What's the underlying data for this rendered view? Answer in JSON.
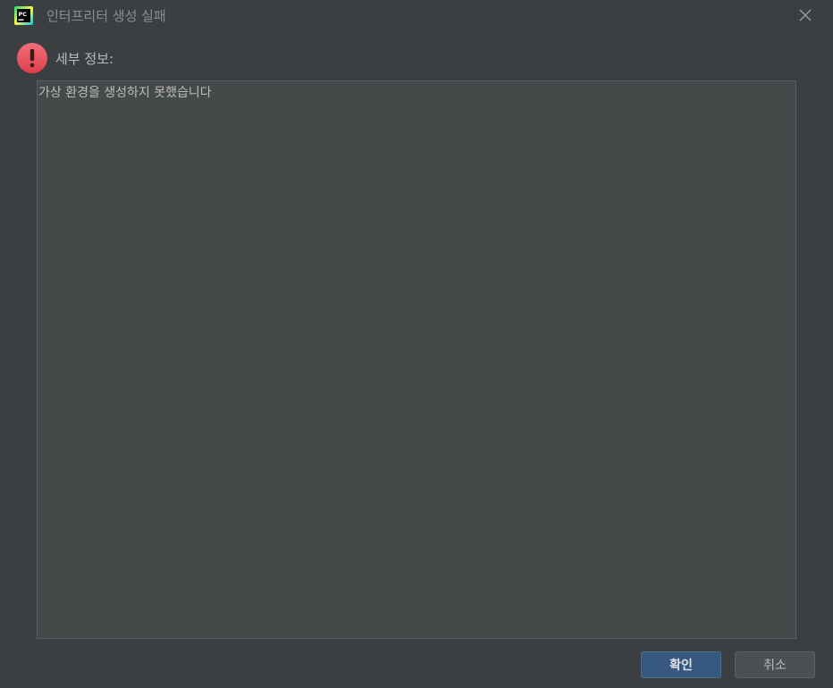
{
  "window": {
    "title": "인터프리터 생성 실패",
    "app_icon": "pycharm-logo-icon",
    "close_icon": "close-icon"
  },
  "message": {
    "icon": "error-icon",
    "label": "세부 정보:",
    "details_text": "가상 환경을 생성하지 못했습니다"
  },
  "buttons": {
    "ok_label": "확인",
    "cancel_label": "취소"
  },
  "colors": {
    "background": "#3c3f41",
    "text_area_bg": "#45494a",
    "primary_button": "#365880",
    "error_red": "#e8505b"
  }
}
